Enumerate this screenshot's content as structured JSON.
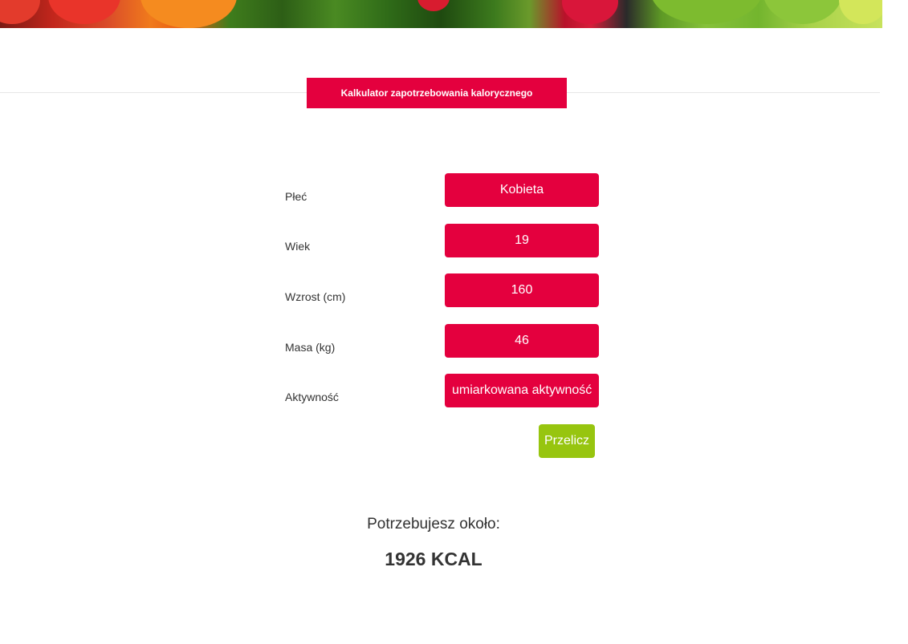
{
  "header": {
    "title": "Kalkulator zapotrzebowania kalorycznego"
  },
  "form": {
    "gender": {
      "label": "Płeć",
      "value": "Kobieta"
    },
    "age": {
      "label": "Wiek",
      "value": "19"
    },
    "height": {
      "label": "Wzrost (cm)",
      "value": "160"
    },
    "weight": {
      "label": "Masa (kg)",
      "value": "46"
    },
    "activity": {
      "label": "Aktywność",
      "value": "umiarkowana aktywność"
    },
    "submit_label": "Przelicz"
  },
  "result": {
    "caption": "Potrzebujesz około:",
    "value": "1926 KCAL"
  },
  "colors": {
    "accent": "#e4003e",
    "button": "#97c50f",
    "text": "#333333"
  }
}
